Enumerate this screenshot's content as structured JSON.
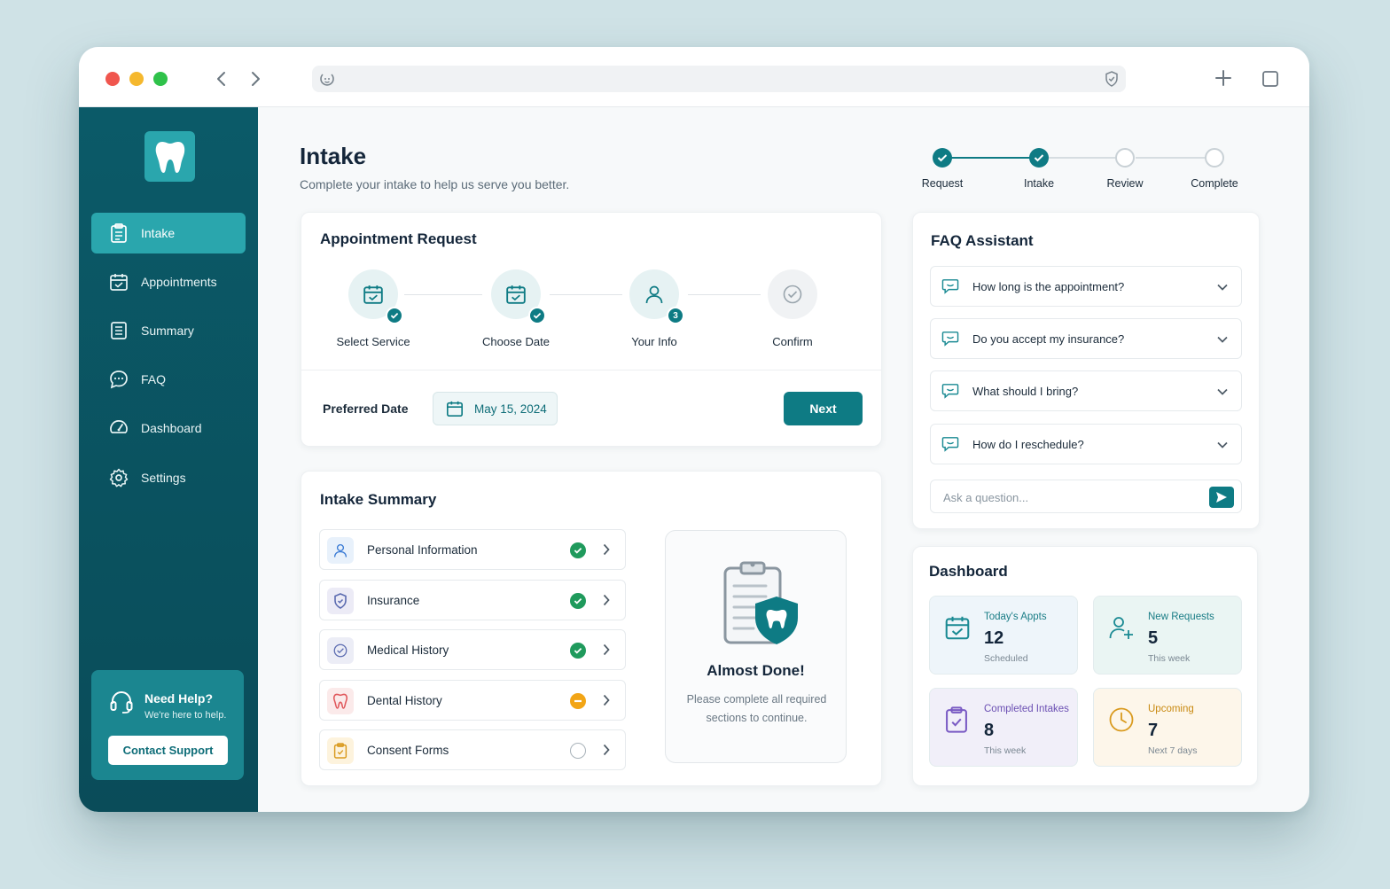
{
  "sidebar": {
    "items": [
      {
        "label": "Intake",
        "icon": "clipboard-icon"
      },
      {
        "label": "Appointments",
        "icon": "calendar-icon"
      },
      {
        "label": "Summary",
        "icon": "document-icon"
      },
      {
        "label": "FAQ",
        "icon": "chat-icon"
      },
      {
        "label": "Dashboard",
        "icon": "gauge-icon"
      },
      {
        "label": "Settings",
        "icon": "gear-icon"
      }
    ],
    "help": {
      "title": "Need Help?",
      "subtitle": "We're here to help.",
      "button": "Contact Support"
    }
  },
  "header": {
    "title": "Intake",
    "subtitle": "Complete your intake to help us serve you better."
  },
  "progress": {
    "steps": [
      {
        "label": "Request",
        "state": "done"
      },
      {
        "label": "Intake",
        "state": "done"
      },
      {
        "label": "Review",
        "state": "todo"
      },
      {
        "label": "Complete",
        "state": "todo"
      }
    ]
  },
  "appointment": {
    "title": "Appointment Request",
    "steps": [
      {
        "label": "Select Service",
        "badge": "check"
      },
      {
        "label": "Choose Date",
        "badge": "check"
      },
      {
        "label": "Your Info",
        "badge": "3"
      },
      {
        "label": "Confirm",
        "badge": ""
      }
    ],
    "preferred_label": "Preferred Date",
    "preferred_date": "May 15, 2024",
    "next_label": "Next"
  },
  "summary": {
    "title": "Intake Summary",
    "rows": [
      {
        "label": "Personal Information",
        "status": "complete"
      },
      {
        "label": "Insurance",
        "status": "complete"
      },
      {
        "label": "Medical History",
        "status": "complete"
      },
      {
        "label": "Dental History",
        "status": "in-progress"
      },
      {
        "label": "Consent Forms",
        "status": "not-started"
      }
    ],
    "panel_title": "Almost Done!",
    "panel_text": "Please complete all required sections to continue."
  },
  "faq": {
    "title": "FAQ Assistant",
    "questions": [
      "How long is the appointment?",
      "Do you accept my insurance?",
      "What should I bring?",
      "How do I reschedule?"
    ],
    "input_placeholder": "Ask a question..."
  },
  "dashboard": {
    "title": "Dashboard",
    "stats": [
      {
        "label": "Today's Appts",
        "value": "12",
        "sub": "Scheduled",
        "color": "#1a8a93"
      },
      {
        "label": "New Requests",
        "value": "5",
        "sub": "This week",
        "color": "#1a8a93"
      },
      {
        "label": "Completed Intakes",
        "value": "8",
        "sub": "This week",
        "color": "#7a5bc4"
      },
      {
        "label": "Upcoming",
        "value": "7",
        "sub": "Next 7 days",
        "color": "#d99a1e"
      }
    ]
  },
  "colors": {
    "accent": "#0e7b84",
    "sidebar": "#0b5a68",
    "complete": "#1f9a5c",
    "in_progress": "#f2a516"
  }
}
